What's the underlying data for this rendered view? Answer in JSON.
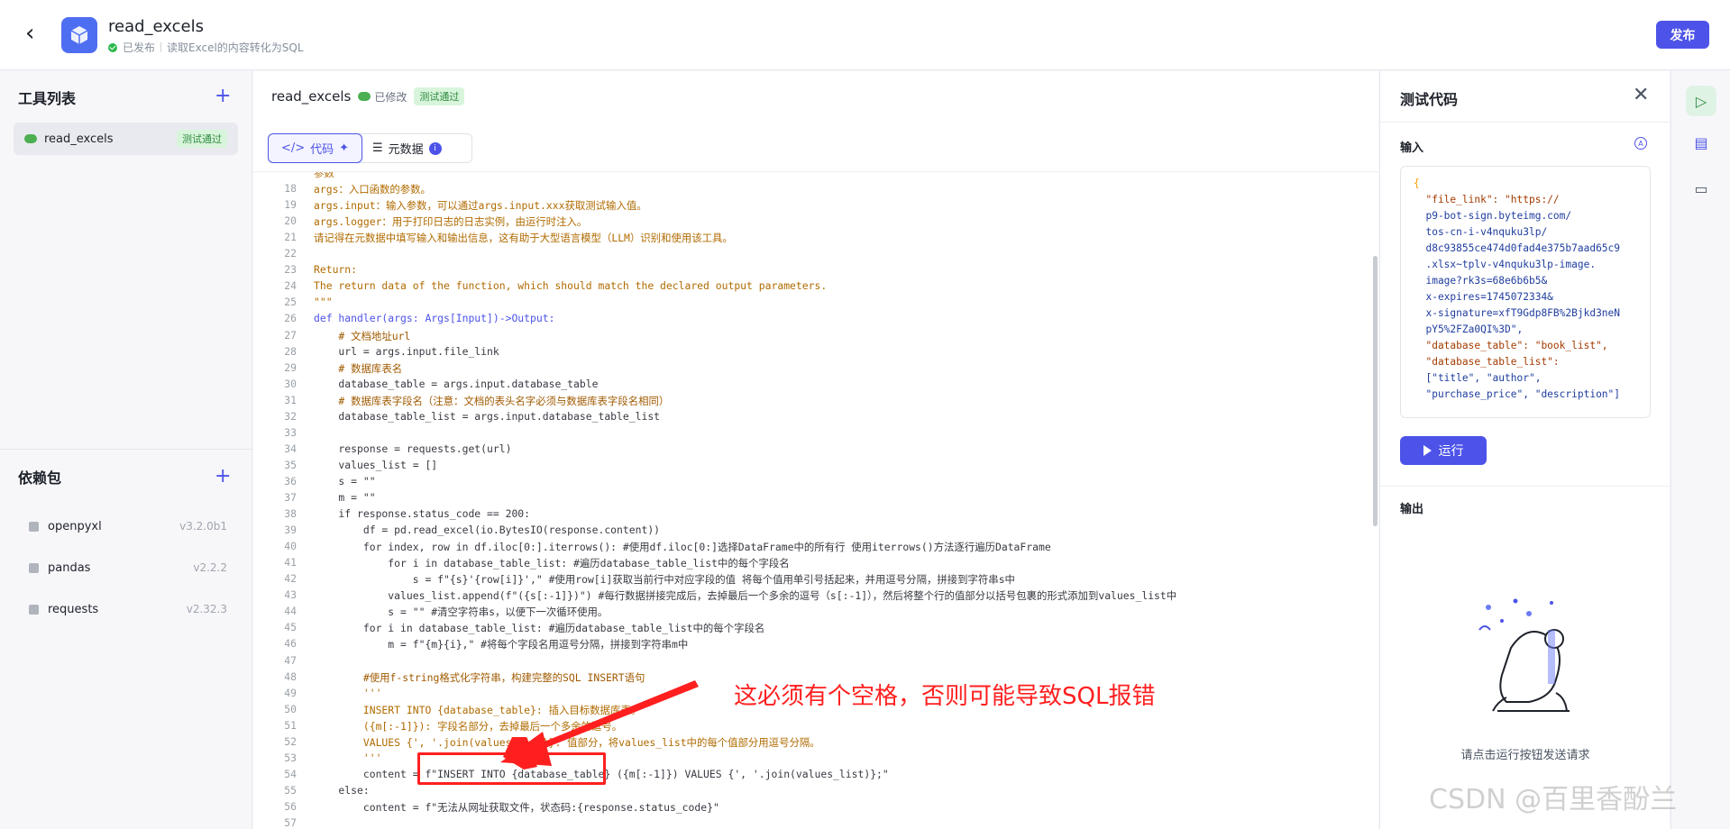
{
  "header": {
    "title": "read_excels",
    "status": "已发布",
    "description": "读取Excel的内容转化为SQL",
    "publish_label": "发布"
  },
  "tools": {
    "title": "工具列表",
    "items": [
      {
        "name": "read_excels",
        "badge": "测试通过"
      }
    ]
  },
  "deps": {
    "title": "依赖包",
    "items": [
      {
        "name": "openpyxl",
        "version": "v3.2.0b1"
      },
      {
        "name": "pandas",
        "version": "v2.2.2"
      },
      {
        "name": "requests",
        "version": "v2.32.3"
      }
    ]
  },
  "editor": {
    "title": "read_excels",
    "modified": "已修改",
    "badge": "测试通过",
    "tab_code": "代码",
    "tab_meta": "元数据",
    "lines": [
      {
        "n": "",
        "t": "参数",
        "cls": "doc"
      },
      {
        "n": "18",
        "t": "args：入口函数的参数。",
        "cls": "doc"
      },
      {
        "n": "19",
        "t": "args.input：输入参数，可以通过args.input.xxx获取测试输入值。",
        "cls": "doc"
      },
      {
        "n": "20",
        "t": "args.logger：用于打印日志的日志实例，由运行时注入。",
        "cls": "doc"
      },
      {
        "n": "21",
        "t": "请记得在元数据中填写输入和输出信息，这有助于大型语言模型（LLM）识别和使用该工具。",
        "cls": "doc"
      },
      {
        "n": "22",
        "t": "",
        "cls": ""
      },
      {
        "n": "23",
        "t": "Return:",
        "cls": "doc"
      },
      {
        "n": "24",
        "t": "The return data of the function, which should match the declared output parameters.",
        "cls": "doc"
      },
      {
        "n": "25",
        "t": "\"\"\"",
        "cls": "doc"
      },
      {
        "n": "26",
        "t": "def handler(args: Args[Input])->Output:",
        "cls": "kwline"
      },
      {
        "n": "27",
        "t": "    # 文档地址url",
        "cls": "cm"
      },
      {
        "n": "28",
        "t": "    url = args.input.file_link",
        "cls": ""
      },
      {
        "n": "29",
        "t": "    # 数据库表名",
        "cls": "cm"
      },
      {
        "n": "30",
        "t": "    database_table = args.input.database_table",
        "cls": ""
      },
      {
        "n": "31",
        "t": "    # 数据库表字段名（注意：文档的表头名字必须与数据库表字段名相同）",
        "cls": "cm"
      },
      {
        "n": "32",
        "t": "    database_table_list = args.input.database_table_list",
        "cls": ""
      },
      {
        "n": "33",
        "t": "",
        "cls": ""
      },
      {
        "n": "34",
        "t": "    response = requests.get(url)",
        "cls": ""
      },
      {
        "n": "35",
        "t": "    values_list = []",
        "cls": ""
      },
      {
        "n": "36",
        "t": "    s = \"\"",
        "cls": ""
      },
      {
        "n": "37",
        "t": "    m = \"\"",
        "cls": ""
      },
      {
        "n": "38",
        "t": "    if response.status_code == 200:",
        "cls": ""
      },
      {
        "n": "39",
        "t": "        df = pd.read_excel(io.BytesIO(response.content))",
        "cls": ""
      },
      {
        "n": "40",
        "t": "        for index, row in df.iloc[0:].iterrows(): #使用df.iloc[0:]选择DataFrame中的所有行 使用iterrows()方法逐行遍历DataFrame",
        "cls": ""
      },
      {
        "n": "41",
        "t": "            for i in database_table_list: #遍历database_table_list中的每个字段名",
        "cls": ""
      },
      {
        "n": "42",
        "t": "                s = f\"{s}'{row[i]}',\" #使用row[i]获取当前行中对应字段的值 将每个值用单引号括起来，并用逗号分隔，拼接到字符串s中",
        "cls": ""
      },
      {
        "n": "43",
        "t": "            values_list.append(f\"({s[:-1]})\") #每行数据拼接完成后，去掉最后一个多余的逗号（s[:-1]），然后将整个行的值部分以括号包裹的形式添加到values_list中",
        "cls": ""
      },
      {
        "n": "44",
        "t": "            s = \"\" #清空字符串s，以便下一次循环使用。",
        "cls": ""
      },
      {
        "n": "45",
        "t": "        for i in database_table_list: #遍历database_table_list中的每个字段名",
        "cls": ""
      },
      {
        "n": "46",
        "t": "            m = f\"{m}{i},\" #将每个字段名用逗号分隔，拼接到字符串m中",
        "cls": ""
      },
      {
        "n": "47",
        "t": "",
        "cls": ""
      },
      {
        "n": "48",
        "t": "        #使用f-string格式化字符串，构建完整的SQL INSERT语句",
        "cls": "cm"
      },
      {
        "n": "49",
        "t": "        '''",
        "cls": "doc"
      },
      {
        "n": "50",
        "t": "        INSERT INTO {database_table}: 插入目标数据库表。",
        "cls": "doc"
      },
      {
        "n": "51",
        "t": "        ({m[:-1]}): 字段名部分，去掉最后一个多余的逗号。",
        "cls": "doc"
      },
      {
        "n": "52",
        "t": "        VALUES {', '.join(values_list)}: 值部分，将values_list中的每个值部分用逗号分隔。",
        "cls": "doc"
      },
      {
        "n": "53",
        "t": "        '''",
        "cls": "doc"
      },
      {
        "n": "54",
        "t": "        content = f\"INSERT INTO {database_table} ({m[:-1]}) VALUES {', '.join(values_list)};\"",
        "cls": ""
      },
      {
        "n": "55",
        "t": "    else:",
        "cls": ""
      },
      {
        "n": "56",
        "t": "        content = f\"无法从网址获取文件，状态码:{response.status_code}\"",
        "cls": ""
      },
      {
        "n": "57",
        "t": "",
        "cls": ""
      }
    ]
  },
  "annotation": {
    "text": "这必须有个空格，否则可能导致SQL报错",
    "color": "#ff1f1f"
  },
  "test_panel": {
    "title": "测试代码",
    "input_label": "输入",
    "json_lines": [
      "{",
      "  \"file_link\": \"https://",
      "  p9-bot-sign.byteimg.com/",
      "  tos-cn-i-v4nquku3lp/",
      "  d8c93855ce474d0fad4e375b7aad65c9",
      "  .xlsx~tplv-v4nquku3lp-image.",
      "  image?rk3s=68e6b6b5&",
      "  x-expires=1745072334&",
      "  x-signature=xfT9Gdp8FB%2Bjkd3neN",
      "  pY5%2FZa0QI%3D\",",
      "  \"database_table\": \"book_list\",",
      "  \"database_table_list\":",
      "  [\"title\", \"author\",",
      "  \"purchase_price\", \"description\"]"
    ],
    "run_label": "运行",
    "output_label": "输出",
    "empty_hint": "请点击运行按钮发送请求"
  },
  "watermark": "CSDN @百里香酚兰",
  "colors": {
    "accent": "#4d53e8",
    "success": "#2db84d"
  }
}
